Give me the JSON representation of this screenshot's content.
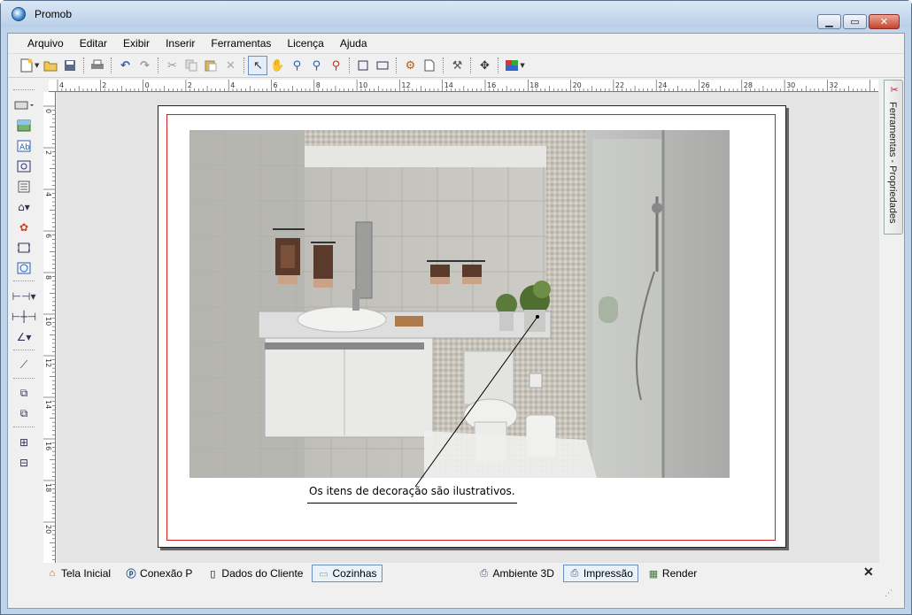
{
  "window": {
    "title": "Promob"
  },
  "menu": [
    "Arquivo",
    "Editar",
    "Exibir",
    "Inserir",
    "Ferramentas",
    "Licença",
    "Ajuda"
  ],
  "icons": {
    "toolbar": [
      "new-document-icon",
      "open-folder-icon",
      "save-icon",
      "print-icon",
      "undo-icon",
      "redo-icon",
      "cut-icon",
      "copy-icon",
      "paste-icon",
      "delete-icon",
      "select-arrow-icon",
      "pan-hand-icon",
      "zoom-window-icon",
      "zoom-out-icon",
      "zoom-in-icon",
      "fit-page-icon",
      "fit-selection-icon",
      "page-setup-icon",
      "page-icon",
      "hammer-icon",
      "move-icon",
      "color-icon"
    ],
    "lefttools": [
      "rectangle-icon",
      "image-icon",
      "text-icon",
      "view-icon",
      "list-icon",
      "plan-icon",
      "palette-icon",
      "frame-icon",
      "circle-view-icon",
      "dimension-icon",
      "dimension-chain-icon",
      "angle-dimension-icon",
      "measure-icon",
      "bring-front-icon",
      "send-back-icon",
      "group-icon",
      "ungroup-icon"
    ]
  },
  "ruler": {
    "h": [
      "4",
      "2",
      "0",
      "2",
      "4",
      "6",
      "8",
      "10",
      "12",
      "14",
      "16",
      "18",
      "20",
      "22",
      "24",
      "26",
      "28",
      "30",
      "32"
    ],
    "v": [
      "0",
      "2",
      "4",
      "6",
      "8",
      "10",
      "12",
      "14",
      "16",
      "18",
      "20"
    ]
  },
  "sheet": {
    "caption": "Os itens de decoração são ilustrativos."
  },
  "right_panel": {
    "label": "Ferramentas - Propriedades"
  },
  "tabs": {
    "left": [
      {
        "label": "Tela Inicial",
        "icon": "home-icon",
        "active": false
      },
      {
        "label": "Conexão P",
        "icon": "connection-icon",
        "active": false
      },
      {
        "label": "Dados do Cliente",
        "icon": "document-icon",
        "active": false
      },
      {
        "label": "Cozinhas",
        "icon": "folder-icon",
        "active": true
      }
    ],
    "right": [
      {
        "label": "Ambiente 3D",
        "icon": "environment-3d-icon",
        "active": false
      },
      {
        "label": "Impressão",
        "icon": "print-layout-icon",
        "active": true
      },
      {
        "label": "Render",
        "icon": "render-icon",
        "active": false
      }
    ]
  }
}
